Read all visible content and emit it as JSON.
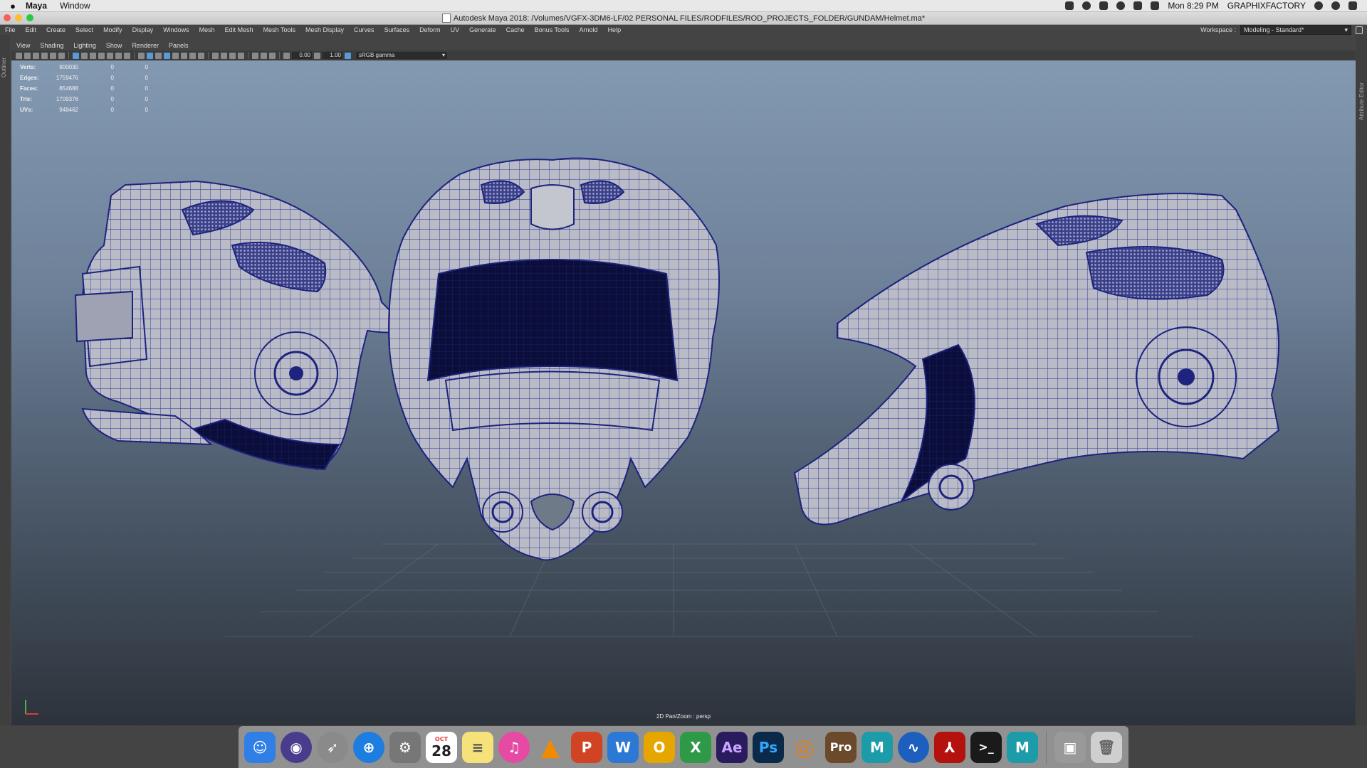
{
  "mac_menubar": {
    "apple": "",
    "app_name": "Maya",
    "items": [
      "Window"
    ],
    "clock": "Mon 8:29 PM",
    "user": "GRAPHIXFACTORY"
  },
  "window": {
    "title": "Autodesk Maya 2018: /Volumes/VGFX-3DM6-LF/02 PERSONAL FILES/RODFILES/ROD_PROJECTS_FOLDER/GUNDAM/Helmet.ma*"
  },
  "maya_menu": {
    "items": [
      "File",
      "Edit",
      "Create",
      "Select",
      "Modify",
      "Display",
      "Windows",
      "Mesh",
      "Edit Mesh",
      "Mesh Tools",
      "Mesh Display",
      "Curves",
      "Surfaces",
      "Deform",
      "UV",
      "Generate",
      "Cache",
      "Bonus Tools",
      "Arnold",
      "Help"
    ],
    "workspace_label": "Workspace :",
    "workspace_value": "Modeling - Standard*"
  },
  "side_panels": {
    "left": "Outliner",
    "right": "Attribute Editor"
  },
  "panel_menu": {
    "items": [
      "View",
      "Shading",
      "Lighting",
      "Show",
      "Renderer",
      "Panels"
    ]
  },
  "toolbar": {
    "exposure": "0.00",
    "gamma": "1.00",
    "colorspace": "sRGB gamma"
  },
  "hud": {
    "rows": [
      {
        "label": "Verts:",
        "v1": "900030",
        "v2": "0",
        "v3": "0"
      },
      {
        "label": "Edges:",
        "v1": "1759476",
        "v2": "0",
        "v3": "0"
      },
      {
        "label": "Faces:",
        "v1": "854688",
        "v2": "0",
        "v3": "0"
      },
      {
        "label": "Tris:",
        "v1": "1709376",
        "v2": "0",
        "v3": "0"
      },
      {
        "label": "UVs:",
        "v1": "948462",
        "v2": "0",
        "v3": "0"
      }
    ]
  },
  "viewport": {
    "camera_label": "2D Pan/Zoom : persp"
  },
  "dock": {
    "calendar": {
      "month": "OCT",
      "day": "28"
    },
    "apps": [
      {
        "name": "Finder",
        "glyph": "☺",
        "color": "#2f7fe6"
      },
      {
        "name": "Siri",
        "glyph": "◉",
        "color": "#4a3c8c"
      },
      {
        "name": "Launchpad",
        "glyph": "➶",
        "color": "#8a8a8a"
      },
      {
        "name": "Safari",
        "glyph": "⊕",
        "color": "#1e7de0"
      },
      {
        "name": "System Preferences",
        "glyph": "⚙",
        "color": "#777777"
      },
      {
        "name": "Calendar",
        "glyph": "",
        "color": "#ffffff"
      },
      {
        "name": "Notes",
        "glyph": "≡",
        "color": "#f5e27a"
      },
      {
        "name": "iTunes",
        "glyph": "♫",
        "color": "#e64aa3"
      },
      {
        "name": "VLC",
        "glyph": "▲",
        "color": "#f08a00"
      },
      {
        "name": "PowerPoint",
        "glyph": "P",
        "color": "#d04423"
      },
      {
        "name": "Word",
        "glyph": "W",
        "color": "#2b79d5"
      },
      {
        "name": "Outlook",
        "glyph": "O",
        "color": "#e6a600"
      },
      {
        "name": "Excel",
        "glyph": "X",
        "color": "#2e9a47"
      },
      {
        "name": "After Effects",
        "glyph": "Ae",
        "color": "#2a1a5e"
      },
      {
        "name": "Photoshop",
        "glyph": "Ps",
        "color": "#0b2a4a"
      },
      {
        "name": "Blender",
        "glyph": "◎",
        "color": "#e87d0d"
      },
      {
        "name": "Pro",
        "glyph": "Pro",
        "color": "#6a4a2a"
      },
      {
        "name": "Maya",
        "glyph": "M",
        "color": "#1c9ba8"
      },
      {
        "name": "Wave",
        "glyph": "∿",
        "color": "#1d5fbf"
      },
      {
        "name": "Acrobat",
        "glyph": "⅄",
        "color": "#b3120e"
      },
      {
        "name": "Terminal",
        "glyph": ">_",
        "color": "#1a1a1a"
      },
      {
        "name": "Maya 2",
        "glyph": "M",
        "color": "#1c9ba8"
      },
      {
        "name": "Preview",
        "glyph": "▣",
        "color": "#999999"
      },
      {
        "name": "Trash",
        "glyph": "🗑",
        "color": "#cfcfcf"
      }
    ]
  }
}
